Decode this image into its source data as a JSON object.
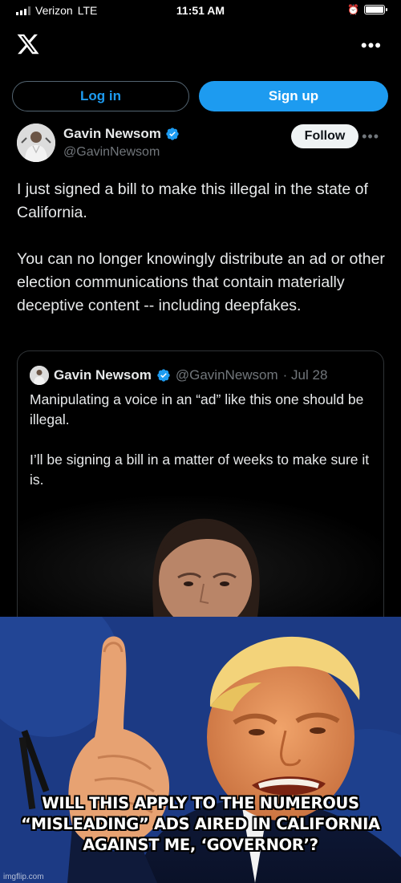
{
  "status_bar": {
    "carrier": "Verizon",
    "network": "LTE",
    "time": "11:51 AM",
    "alarm_icon": "alarm-icon",
    "battery_icon": "battery-icon",
    "battery_level": 1.0
  },
  "app_bar": {
    "logo_icon": "x-logo-icon",
    "more_icon": "more-horizontal-icon",
    "more_glyph": "•••"
  },
  "auth": {
    "login_label": "Log in",
    "signup_label": "Sign up"
  },
  "tweet": {
    "author_name": "Gavin Newsom",
    "author_handle": "@GavinNewsom",
    "verified_icon": "verified-badge-icon",
    "follow_label": "Follow",
    "more_glyph": "•••",
    "paragraphs": [
      "I just signed a bill to make this illegal in the state of California.",
      "You can no longer knowingly distribute an ad or other election communications that contain materially deceptive content -- including deepfakes."
    ],
    "quote": {
      "author_name": "Gavin Newsom",
      "author_handle": "@GavinNewsom",
      "date": "· Jul 28",
      "paragraphs": [
        "Manipulating a voice in an “ad” like this one should be illegal.",
        "I’ll be signing a bill in a matter of weeks to make sure it is."
      ]
    }
  },
  "meme": {
    "caption": "WILL THIS APPLY TO THE NUMEROUS “MISLEADING” ADS AIRED IN CALIFORNIA AGAINST ME, ‘GOVERNOR’?",
    "watermark": "imgflip.com"
  },
  "colors": {
    "accent": "#1d9bf0",
    "background": "#000000",
    "text": "#e7e9ea",
    "muted": "#71767b",
    "border": "#2f3336"
  }
}
